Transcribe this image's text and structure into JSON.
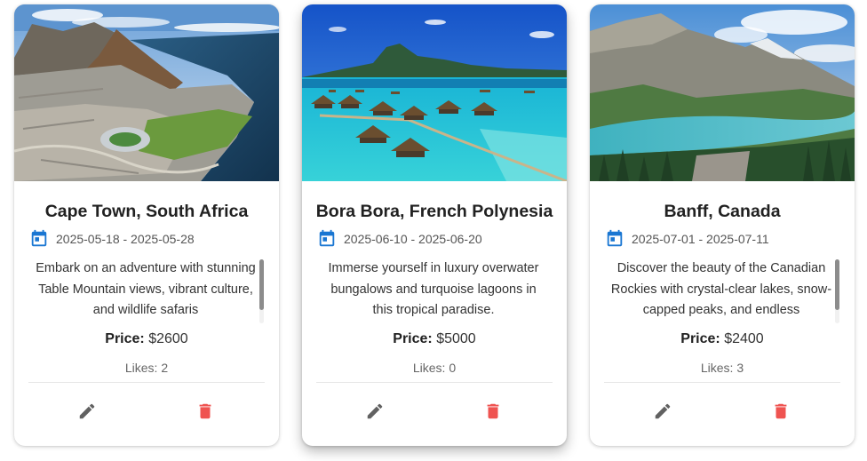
{
  "trips": [
    {
      "destination": "Cape Town, South Africa",
      "dates": "2025-05-18 - 2025-05-28",
      "description": "Embark on an adventure with stunning Table Mountain views, vibrant culture, and wildlife safaris",
      "price_label": "Price:",
      "price": "$2600",
      "likes": "Likes: 2",
      "image_icon": "cape-town-photo"
    },
    {
      "destination": "Bora Bora, French Polynesia",
      "dates": "2025-06-10 - 2025-06-20",
      "description": "Immerse yourself in luxury overwater bungalows and turquoise lagoons in this tropical paradise.",
      "price_label": "Price:",
      "price": "$5000",
      "likes": "Likes: 0",
      "image_icon": "bora-bora-photo"
    },
    {
      "destination": "Banff, Canada",
      "dates": "2025-07-01 - 2025-07-11",
      "description": "Discover the beauty of the Canadian Rockies with crystal-clear lakes, snow-capped peaks, and endless",
      "price_label": "Price:",
      "price": "$2400",
      "likes": "Likes: 3",
      "image_icon": "banff-photo"
    }
  ],
  "icons": {
    "calendar": "calendar-icon",
    "edit": "pencil-icon",
    "delete": "trash-icon"
  },
  "colors": {
    "calendar": "#1976d2",
    "edit": "#616161",
    "delete": "#ef5350",
    "scroll_thumb": "#8c8c8c"
  }
}
